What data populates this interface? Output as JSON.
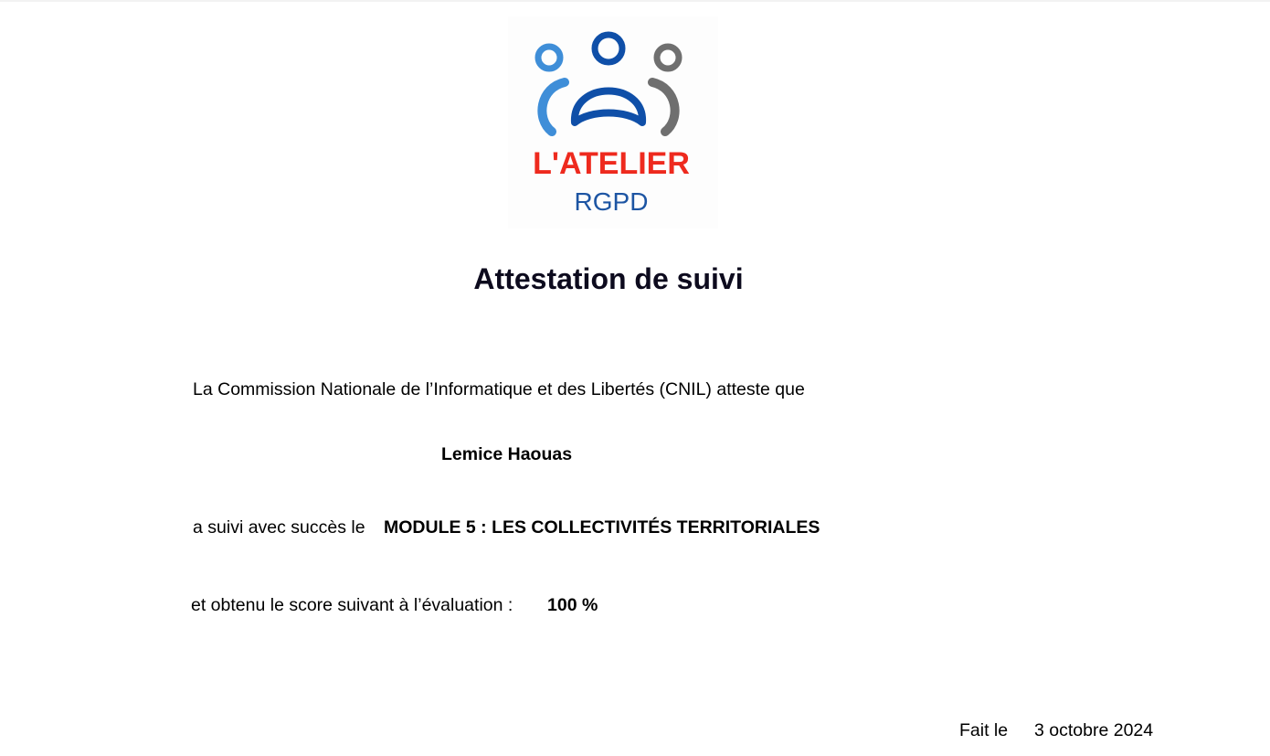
{
  "logo": {
    "line1": "L'ATELIER",
    "line2": "RGPD",
    "colors": {
      "red": "#ee2a1e",
      "navy": "#1d55a3",
      "dark_blue": "#0f4fa8",
      "light_blue": "#3f8ed8",
      "gray": "#6f6f6f"
    }
  },
  "certificate": {
    "title": "Attestation de suivi",
    "intro": "La Commission Nationale de l’Informatique et des Libertés (CNIL) atteste que",
    "recipient": "Lemice Haouas",
    "module_prefix": "a suivi avec succès le",
    "module_title": "MODULE 5 : LES COLLECTIVITÉS TERRITORIALES",
    "score_prefix": "et obtenu le score suivant à l’évaluation :",
    "score_value": "100 %",
    "date_label": "Fait le",
    "date_value": "3 octobre 2024"
  }
}
